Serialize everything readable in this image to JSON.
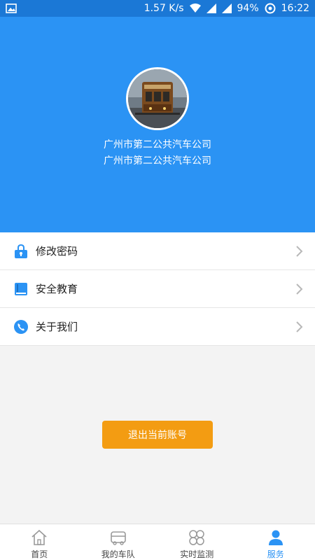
{
  "status": {
    "speed": "1.57 K/s",
    "battery": "94%",
    "time": "16:22"
  },
  "profile": {
    "company_line1": "广州市第二公共汽车公司",
    "company_line2": "广州市第二公共汽车公司"
  },
  "menu": [
    {
      "label": "修改密码",
      "icon": "lock-icon"
    },
    {
      "label": "安全教育",
      "icon": "book-icon"
    },
    {
      "label": "关于我们",
      "icon": "phone-icon"
    }
  ],
  "logout": {
    "label": "退出当前账号"
  },
  "tabs": [
    {
      "label": "首页",
      "icon": "home-icon"
    },
    {
      "label": "我的车队",
      "icon": "bus-icon"
    },
    {
      "label": "实时监测",
      "icon": "monitor-icon"
    },
    {
      "label": "服务",
      "icon": "person-icon"
    }
  ],
  "colors": {
    "header": "#2b93f4",
    "accent": "#2b93f4",
    "button": "#f39c12",
    "tab_active": "#2b93f4"
  }
}
